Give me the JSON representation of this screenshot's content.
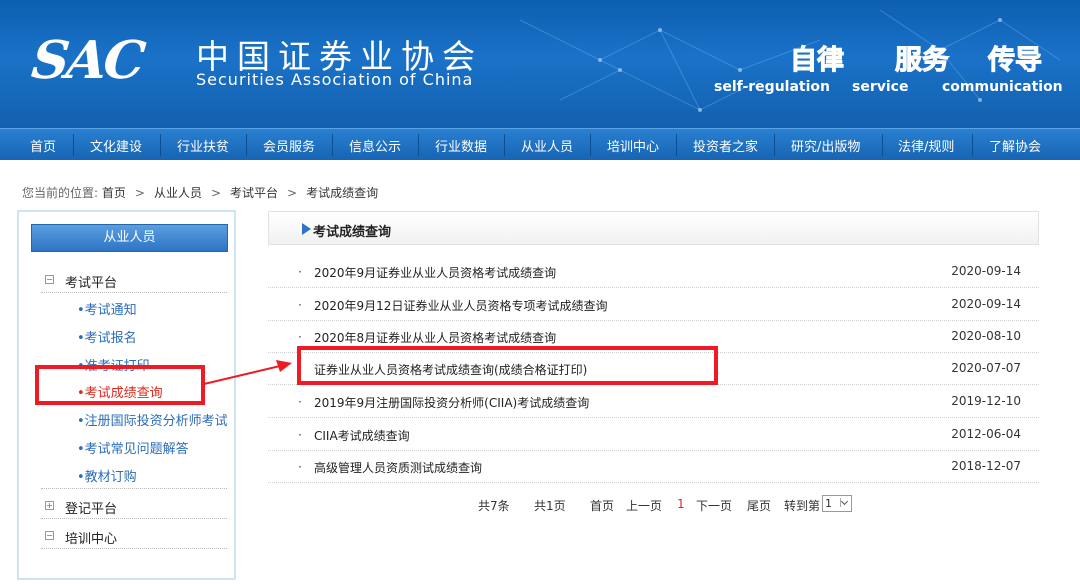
{
  "header": {
    "logo_mark": "SAC",
    "org_name_cn": "中国证券业协会",
    "org_name_en": "Securities Association of China",
    "slogans": [
      {
        "cn": "自律",
        "en": "self-regulation"
      },
      {
        "cn": "服务",
        "en": "service"
      },
      {
        "cn": "传导",
        "en": "communication"
      }
    ]
  },
  "nav": {
    "items": [
      "首页",
      "文化建设",
      "行业扶贫",
      "会员服务",
      "信息公示",
      "行业数据",
      "从业人员",
      "培训中心",
      "投资者之家",
      "研究/出版物",
      "法律/规则",
      "了解协会"
    ]
  },
  "breadcrumb": {
    "lead": "您当前的位置:",
    "items": [
      "首页",
      "从业人员",
      "考试平台",
      "考试成绩查询"
    ],
    "separator": ">"
  },
  "sidebar": {
    "title": "从业人员",
    "groups": [
      {
        "label": "考试平台",
        "expander": "−"
      },
      {
        "label": "登记平台",
        "expander": "+"
      },
      {
        "label": "培训中心",
        "expander": "−"
      }
    ],
    "sub_items": [
      {
        "label": "•考试通知"
      },
      {
        "label": "•考试报名"
      },
      {
        "label": "•准考证打印"
      },
      {
        "label": "•考试成绩查询"
      },
      {
        "label": "•注册国际投资分析师考试"
      },
      {
        "label": "•考试常见问题解答"
      },
      {
        "label": "•教材订购"
      }
    ]
  },
  "content": {
    "title": "考试成绩查询",
    "bullet": "·",
    "rows": [
      {
        "title": "2020年9月证券业从业人员资格考试成绩查询",
        "date": "2020-09-14"
      },
      {
        "title": "2020年9月12日证券业从业人员资格专项考试成绩查询",
        "date": "2020-09-14"
      },
      {
        "title": "2020年8月证券业从业人员资格考试成绩查询",
        "date": "2020-08-10"
      },
      {
        "title": "证券业从业人员资格考试成绩查询(成绩合格证打印)",
        "date": "2020-07-07"
      },
      {
        "title": "2019年9月注册国际投资分析师(CIIA)考试成绩查询",
        "date": "2019-12-10"
      },
      {
        "title": "CIIA考试成绩查询",
        "date": "2012-06-04"
      },
      {
        "title": "高级管理人员资质测试成绩查询",
        "date": "2018-12-07"
      }
    ]
  },
  "pager": {
    "total": "共7条",
    "pages": "共1页",
    "first": "首页",
    "prev": "上一页",
    "current": "1",
    "next": "下一页",
    "last": "尾页",
    "jump": "转到第",
    "select_value": "1"
  },
  "colors": {
    "header_blue": "#1a72c8",
    "nav_blue": "#1765b4",
    "link_blue": "#2b6cb8",
    "highlight_red": "#ee1b24",
    "slogan_green": "#bde83a"
  }
}
